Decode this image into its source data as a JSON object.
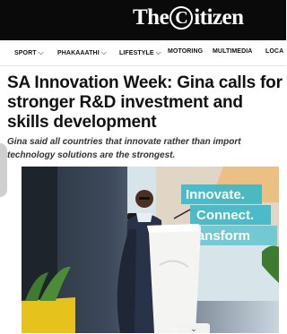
{
  "header": {
    "logo_text_before": "The",
    "logo_circle_letter": "C",
    "logo_text_after": "itizen"
  },
  "nav": {
    "items": [
      {
        "label": "SPORT",
        "has_dropdown": true
      },
      {
        "label": "PHAKAAATHI",
        "has_dropdown": true
      },
      {
        "label": "LIFESTYLE",
        "has_dropdown": true
      },
      {
        "label": "MOTORING",
        "has_dropdown": false
      },
      {
        "label": "MULTIMEDIA",
        "has_dropdown": false
      },
      {
        "label": "LOCA",
        "has_dropdown": false
      }
    ]
  },
  "article": {
    "headline": "SA Innovation Week: Gina calls for stronger R&D investment and skills development",
    "standfirst": "Gina said all countries that innovate rather than import technology solutions are the strongest."
  },
  "hero": {
    "banner_words": [
      "Innovate.",
      "Connect.",
      "ransform"
    ],
    "colors": {
      "banner_bg": "#d7e4ea",
      "banner_text": "#ffffff",
      "panel_teal": "#2fb7c9",
      "backdrop": "#2b3340",
      "plant_green": "#3e7a2f",
      "pot_yellow": "#e6c21d"
    }
  },
  "controls": {
    "expand_icon": "chevron-down-icon"
  }
}
